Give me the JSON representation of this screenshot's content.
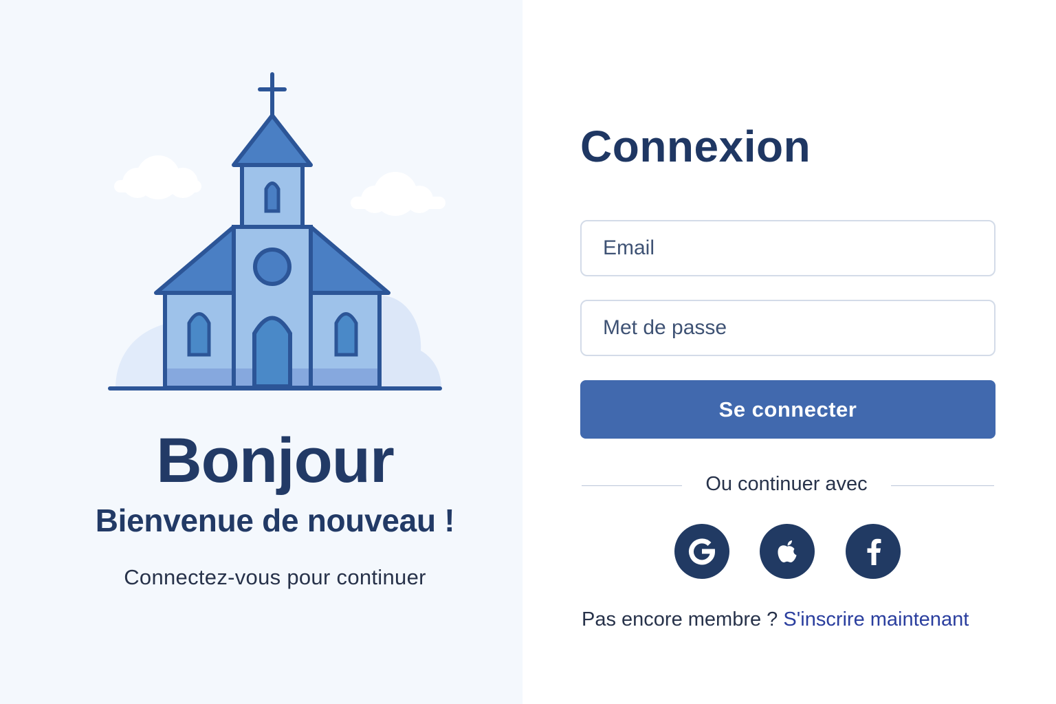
{
  "welcome": {
    "title": "Bonjour",
    "subtitle": "Bienvenue de nouveau !",
    "caption": "Connectez-vous pour continuer",
    "illustration_icon": "church-icon"
  },
  "login": {
    "title": "Connexion",
    "email_placeholder": "Email",
    "password_placeholder": "Met de passe",
    "submit_label": "Se connecter",
    "divider_text": "Ou continuer avec",
    "social": [
      {
        "name": "google",
        "icon": "google-icon"
      },
      {
        "name": "apple",
        "icon": "apple-icon"
      },
      {
        "name": "facebook",
        "icon": "facebook-icon"
      }
    ],
    "signup_prompt": "Pas encore membre ?",
    "signup_link": "S'inscrire maintenant"
  },
  "colors": {
    "left_background": "#f4f8fd",
    "heading": "#223a66",
    "accent_button": "#4169ae",
    "social_button": "#213a63",
    "link": "#2a3e9e"
  }
}
